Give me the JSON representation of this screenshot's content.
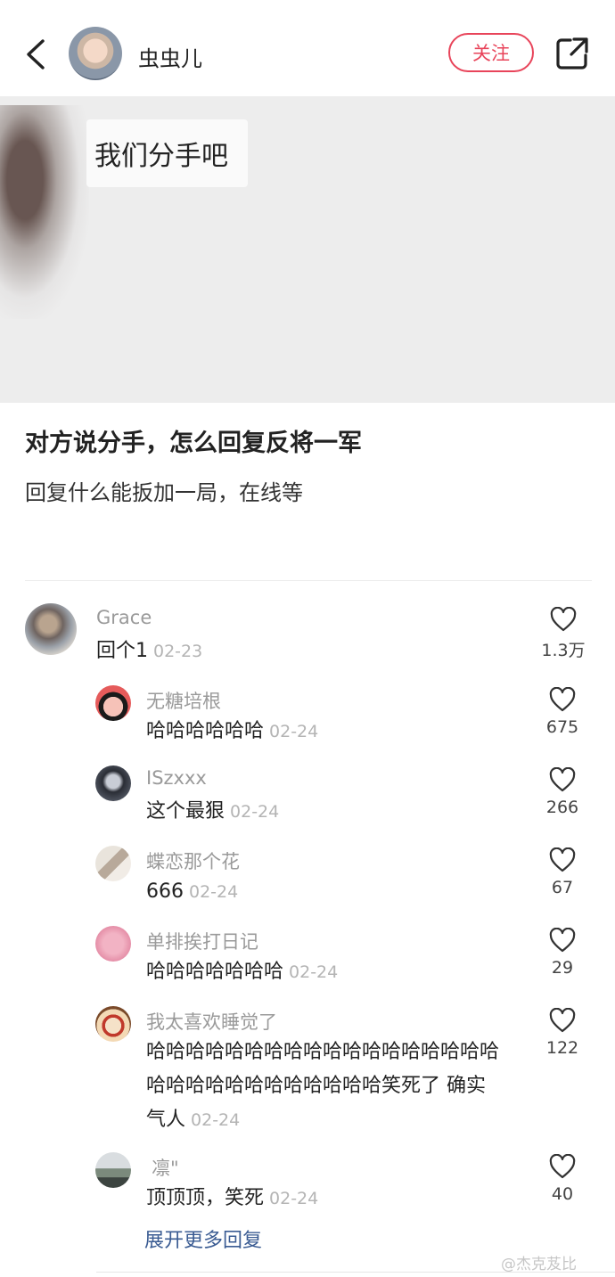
{
  "header": {
    "username": "虫虫儿",
    "follow_label": "关注"
  },
  "post": {
    "image_text": "我们分手吧",
    "title": "对方说分手，怎么回复反将一军",
    "description": "回复什么能扳加一局，在线等"
  },
  "comments": [
    {
      "name": "Grace",
      "text": "回个1",
      "date": "02-23",
      "likes": "1.3万"
    },
    {
      "name": "无糖培根",
      "text": "哈哈哈哈哈哈",
      "date": "02-24",
      "likes": "675"
    },
    {
      "name": "ISzxxx",
      "text": "这个最狠",
      "date": "02-24",
      "likes": "266"
    },
    {
      "name": "蝶恋那个花",
      "text": "666",
      "date": "02-24",
      "likes": "67"
    },
    {
      "name": "单排挨打日记",
      "text": "哈哈哈哈哈哈哈",
      "date": "02-24",
      "likes": "29"
    },
    {
      "name": "我太喜欢睡觉了",
      "text_lines": [
        "哈哈哈哈哈哈哈哈哈哈哈哈哈哈哈哈哈哈",
        "哈哈哈哈哈哈哈哈哈哈哈哈笑死了 确实",
        "气人"
      ],
      "date": "02-24",
      "likes": "122"
    },
    {
      "name": "凛\"",
      "text": "顶顶顶，笑死",
      "date": "02-24",
      "likes": "40"
    }
  ],
  "show_more": "展开更多回复",
  "watermark": "@杰克芨比"
}
